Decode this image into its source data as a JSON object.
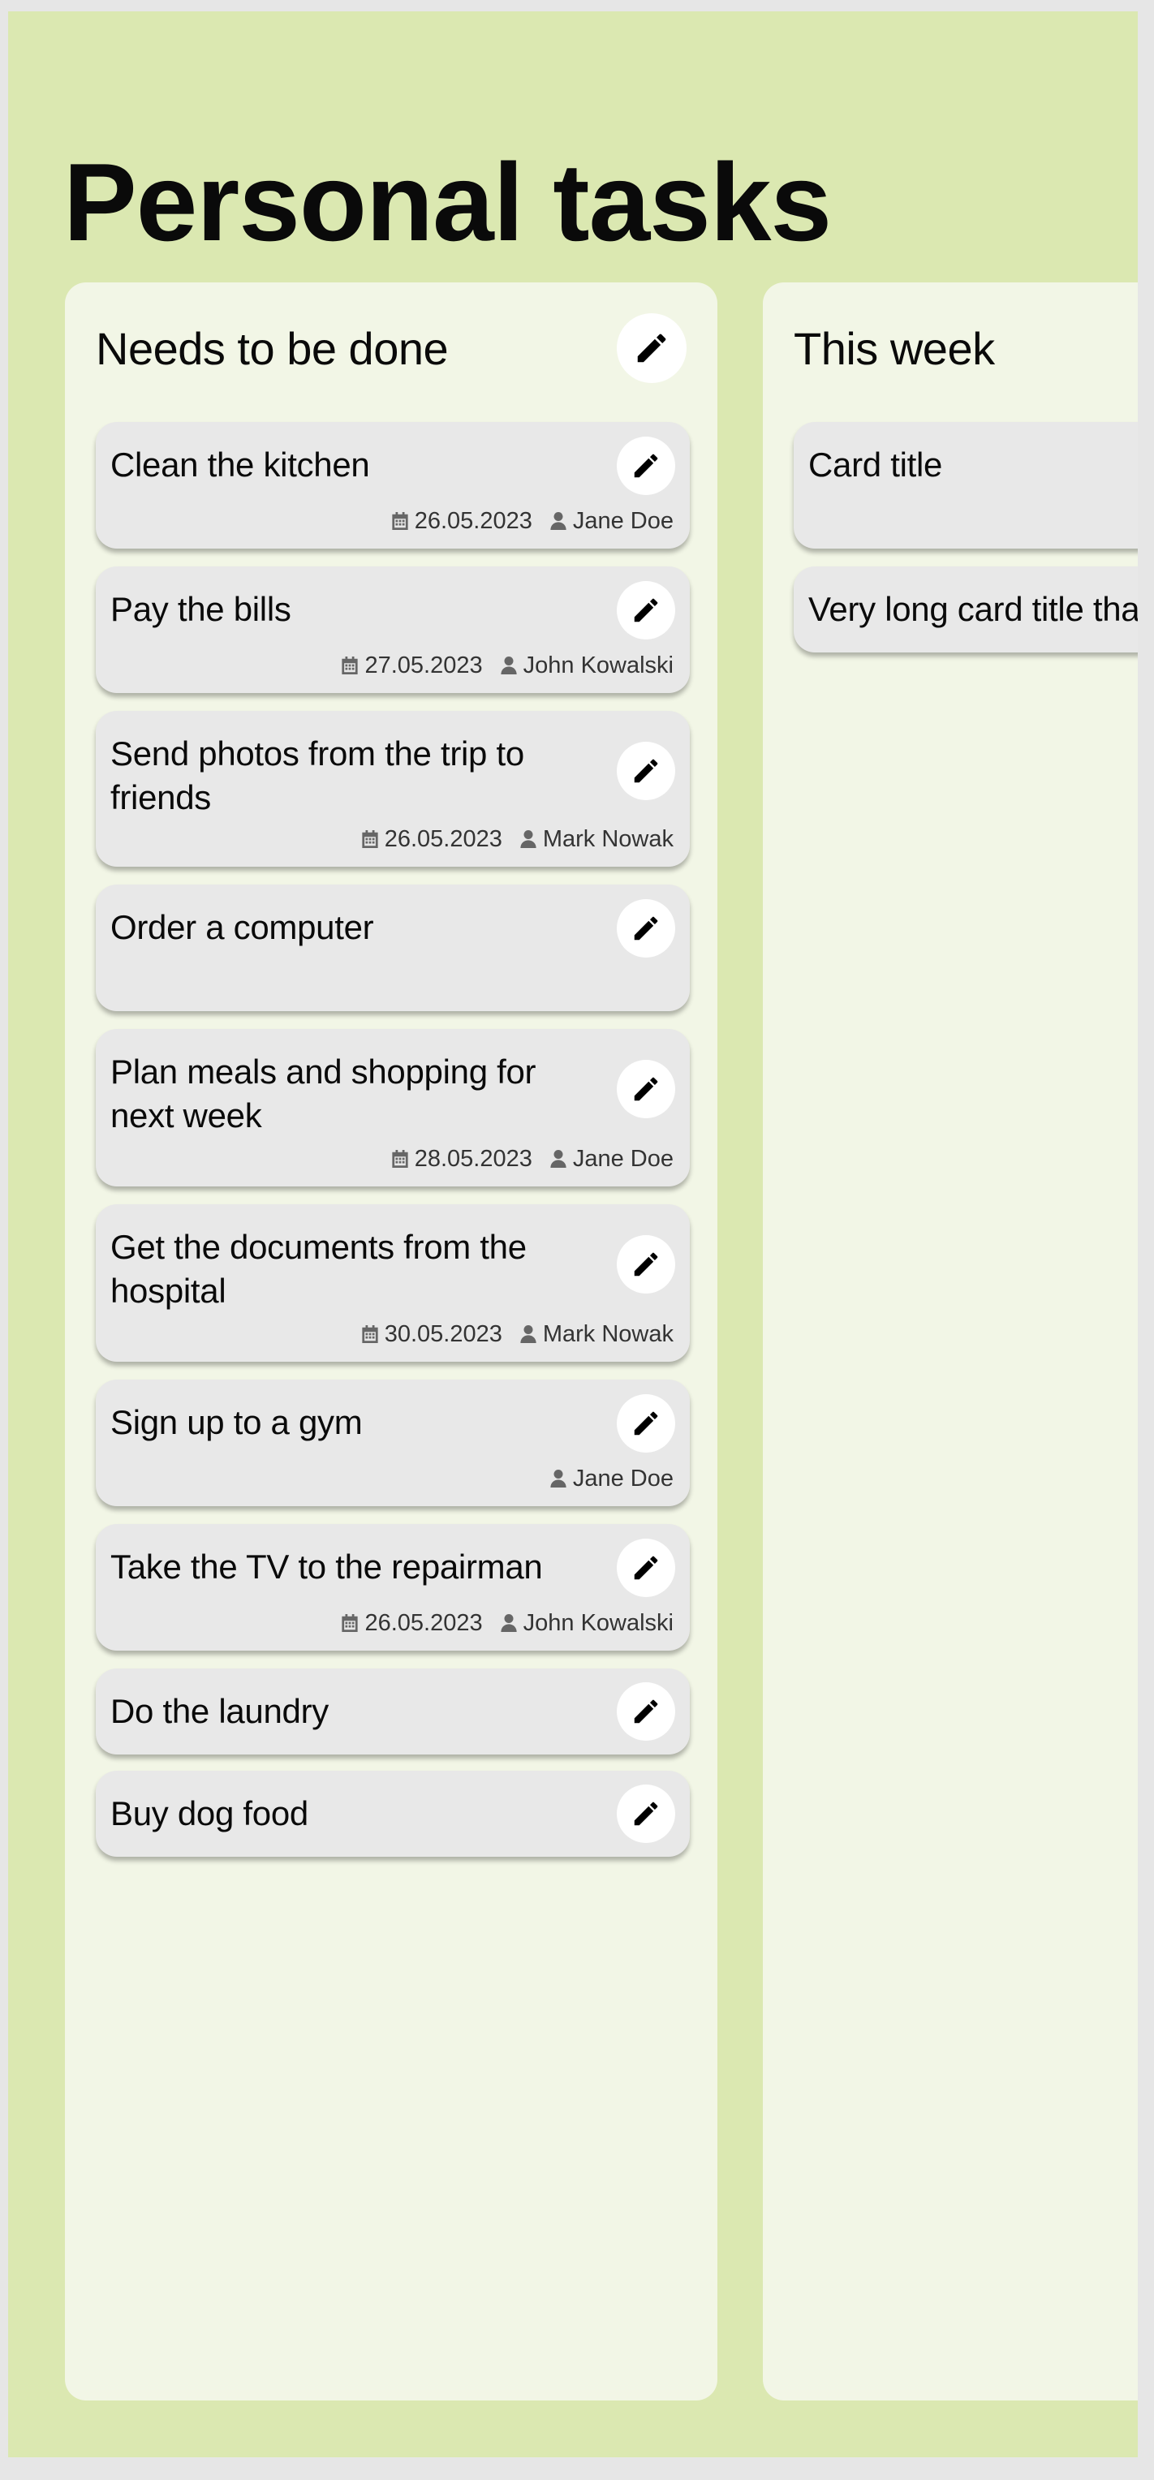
{
  "page": {
    "title": "Personal tasks"
  },
  "colors": {
    "background": "#dbe8b1",
    "column": "#f2f6e6",
    "card": "#e8e8e8",
    "button": "#ffffff",
    "text": "#0a0a0a",
    "meta_text": "#333333",
    "meta_icon": "#666666"
  },
  "icons": {
    "edit": "pencil-icon",
    "date": "calendar-icon",
    "assignee": "user-icon"
  },
  "columns": [
    {
      "title": "Needs to be done",
      "cards": [
        {
          "title": "Clean the kitchen",
          "date": "26.05.2023",
          "assignee": "Jane Doe"
        },
        {
          "title": "Pay the bills",
          "date": "27.05.2023",
          "assignee": "John Kowalski"
        },
        {
          "title": "Send photos from the trip to friends",
          "date": "26.05.2023",
          "assignee": "Mark Nowak"
        },
        {
          "title": "Order a computer"
        },
        {
          "title": "Plan meals and shopping for next week",
          "date": "28.05.2023",
          "assignee": "Jane Doe"
        },
        {
          "title": "Get the documents from the hospital",
          "date": "30.05.2023",
          "assignee": "Mark Nowak"
        },
        {
          "title": "Sign up to a gym",
          "assignee": "Jane Doe"
        },
        {
          "title": "Take the TV to the repairman",
          "date": "26.05.2023",
          "assignee": "John Kowalski"
        },
        {
          "title": "Do the laundry"
        },
        {
          "title": "Buy dog food"
        }
      ]
    },
    {
      "title": "This week",
      "cards": [
        {
          "title": "Card title"
        },
        {
          "title": "Very long card title tha"
        }
      ]
    }
  ]
}
